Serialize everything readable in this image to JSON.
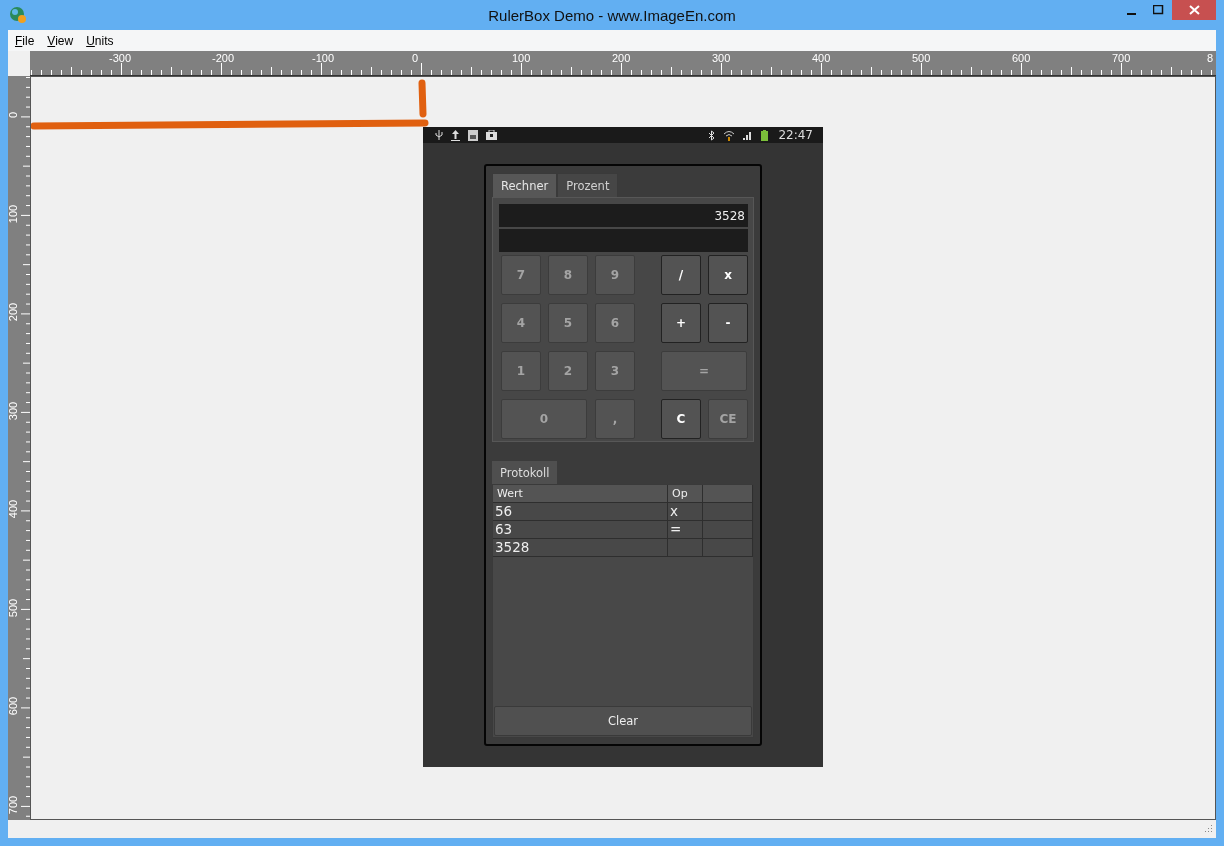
{
  "window": {
    "title": "RulerBox Demo - www.ImageEn.com"
  },
  "menu": [
    {
      "label": "File"
    },
    {
      "label": "View"
    },
    {
      "label": "Units"
    }
  ],
  "ruler_h": {
    "labels": [
      "-300",
      "-200",
      "-100",
      "0",
      "100",
      "200",
      "300",
      "400",
      "500",
      "600",
      "700",
      "8"
    ]
  },
  "ruler_v": {
    "labels": [
      "0",
      "100",
      "200",
      "300",
      "400",
      "500",
      "600",
      "700"
    ]
  },
  "phone": {
    "status_time": "22:47",
    "tabs": [
      {
        "label": "Rechner",
        "selected": true
      },
      {
        "label": "Prozent",
        "selected": false
      }
    ],
    "display": "3528",
    "keys": [
      {
        "label": "7",
        "kind": "plain",
        "wide": false
      },
      {
        "label": "8",
        "kind": "plain",
        "wide": false
      },
      {
        "label": "9",
        "kind": "plain",
        "wide": false
      },
      {
        "label": "/",
        "kind": "strong",
        "wide": false
      },
      {
        "label": "x",
        "kind": "strong",
        "wide": false
      },
      {
        "label": "4",
        "kind": "plain",
        "wide": false
      },
      {
        "label": "5",
        "kind": "plain",
        "wide": false
      },
      {
        "label": "6",
        "kind": "plain",
        "wide": false
      },
      {
        "label": "+",
        "kind": "strong",
        "wide": false
      },
      {
        "label": "-",
        "kind": "strong",
        "wide": false
      },
      {
        "label": "1",
        "kind": "plain",
        "wide": false
      },
      {
        "label": "2",
        "kind": "plain",
        "wide": false
      },
      {
        "label": "3",
        "kind": "plain",
        "wide": false
      },
      {
        "label": "=",
        "kind": "plain",
        "wide": true
      },
      {
        "label": "0",
        "kind": "plain",
        "wide": true
      },
      {
        "label": ",",
        "kind": "plain",
        "wide": false
      },
      {
        "label": "C",
        "kind": "strong",
        "wide": false
      },
      {
        "label": "CE",
        "kind": "plain",
        "wide": false
      }
    ],
    "log": {
      "tab": "Protokoll",
      "columns": [
        "Wert",
        "Op"
      ],
      "rows": [
        {
          "value": "56",
          "op": "x"
        },
        {
          "value": "63",
          "op": "="
        },
        {
          "value": "3528"
        }
      ]
    },
    "clear_button": "Clear"
  }
}
